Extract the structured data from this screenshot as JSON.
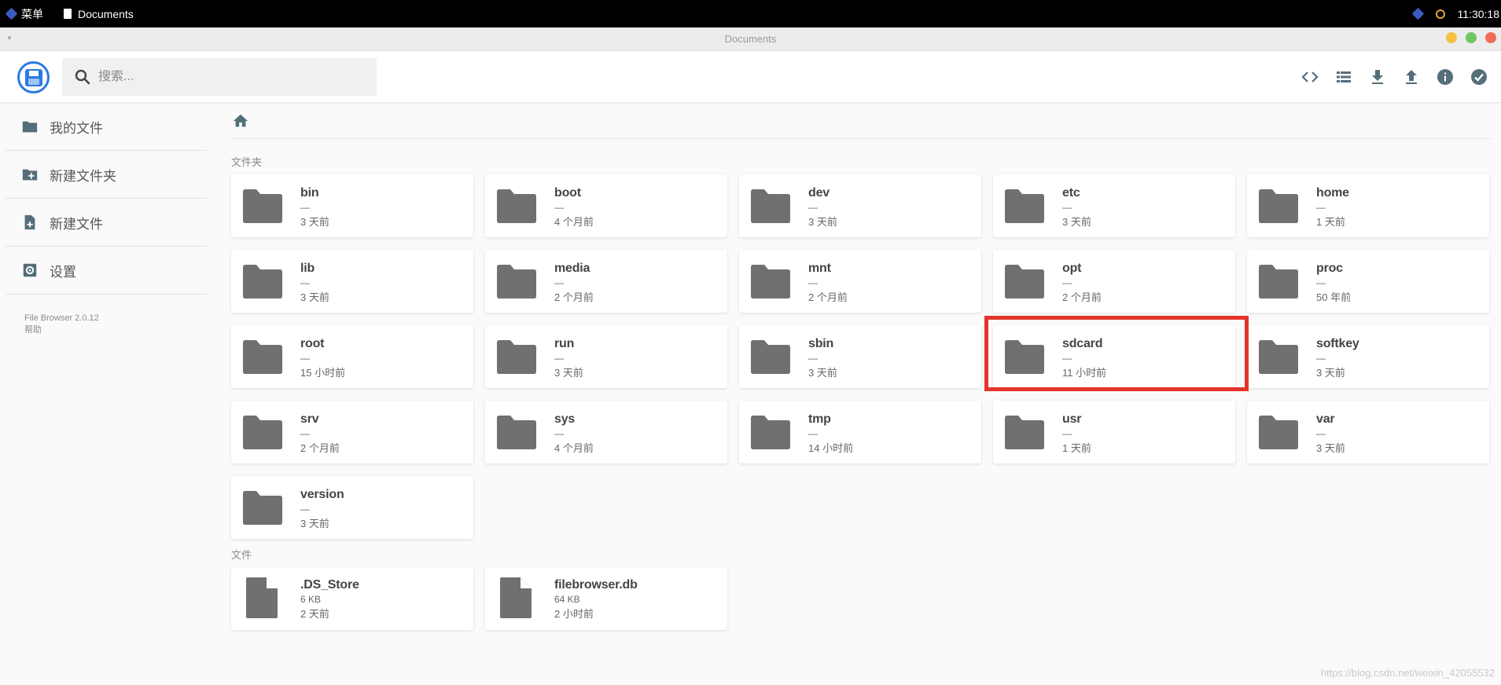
{
  "taskbar": {
    "menu_label": "菜单",
    "window_label": "Documents",
    "clock": "11:30:18"
  },
  "window": {
    "title": "Documents"
  },
  "header": {
    "search_placeholder": "搜索...",
    "actions": [
      {
        "name": "code-icon"
      },
      {
        "name": "list-view-icon"
      },
      {
        "name": "download-icon"
      },
      {
        "name": "upload-icon"
      },
      {
        "name": "info-icon"
      },
      {
        "name": "select-check-icon"
      }
    ]
  },
  "sidebar": {
    "items": [
      {
        "label": "我的文件",
        "icon": "folder-icon"
      },
      {
        "label": "新建文件夹",
        "icon": "new-folder-icon"
      },
      {
        "label": "新建文件",
        "icon": "new-file-icon"
      },
      {
        "label": "设置",
        "icon": "settings-icon"
      }
    ],
    "version": "File Browser 2.0.12",
    "help": "帮助"
  },
  "main": {
    "folders_label": "文件夹",
    "files_label": "文件",
    "folders": [
      {
        "name": "bin",
        "size": "—",
        "modified": "3 天前"
      },
      {
        "name": "boot",
        "size": "—",
        "modified": "4 个月前"
      },
      {
        "name": "dev",
        "size": "—",
        "modified": "3 天前"
      },
      {
        "name": "etc",
        "size": "—",
        "modified": "3 天前"
      },
      {
        "name": "home",
        "size": "—",
        "modified": "1 天前"
      },
      {
        "name": "lib",
        "size": "—",
        "modified": "3 天前"
      },
      {
        "name": "media",
        "size": "—",
        "modified": "2 个月前"
      },
      {
        "name": "mnt",
        "size": "—",
        "modified": "2 个月前"
      },
      {
        "name": "opt",
        "size": "—",
        "modified": "2 个月前"
      },
      {
        "name": "proc",
        "size": "—",
        "modified": "50 年前"
      },
      {
        "name": "root",
        "size": "—",
        "modified": "15 小时前"
      },
      {
        "name": "run",
        "size": "—",
        "modified": "3 天前"
      },
      {
        "name": "sbin",
        "size": "—",
        "modified": "3 天前"
      },
      {
        "name": "sdcard",
        "size": "—",
        "modified": "11 小时前"
      },
      {
        "name": "softkey",
        "size": "—",
        "modified": "3 天前"
      },
      {
        "name": "srv",
        "size": "—",
        "modified": "2 个月前"
      },
      {
        "name": "sys",
        "size": "—",
        "modified": "4 个月前"
      },
      {
        "name": "tmp",
        "size": "—",
        "modified": "14 小时前"
      },
      {
        "name": "usr",
        "size": "—",
        "modified": "1 天前"
      },
      {
        "name": "var",
        "size": "—",
        "modified": "3 天前"
      },
      {
        "name": "version",
        "size": "—",
        "modified": "3 天前"
      }
    ],
    "files": [
      {
        "name": ".DS_Store",
        "size": "6 KB",
        "modified": "2 天前"
      },
      {
        "name": "filebrowser.db",
        "size": "64 KB",
        "modified": "2 小时前"
      }
    ]
  },
  "colors": {
    "accent": "#2a7ae2",
    "icon_gray": "#707070",
    "highlight_red": "#e3342b"
  },
  "watermark": "https://blog.csdn.net/weixin_42055532"
}
